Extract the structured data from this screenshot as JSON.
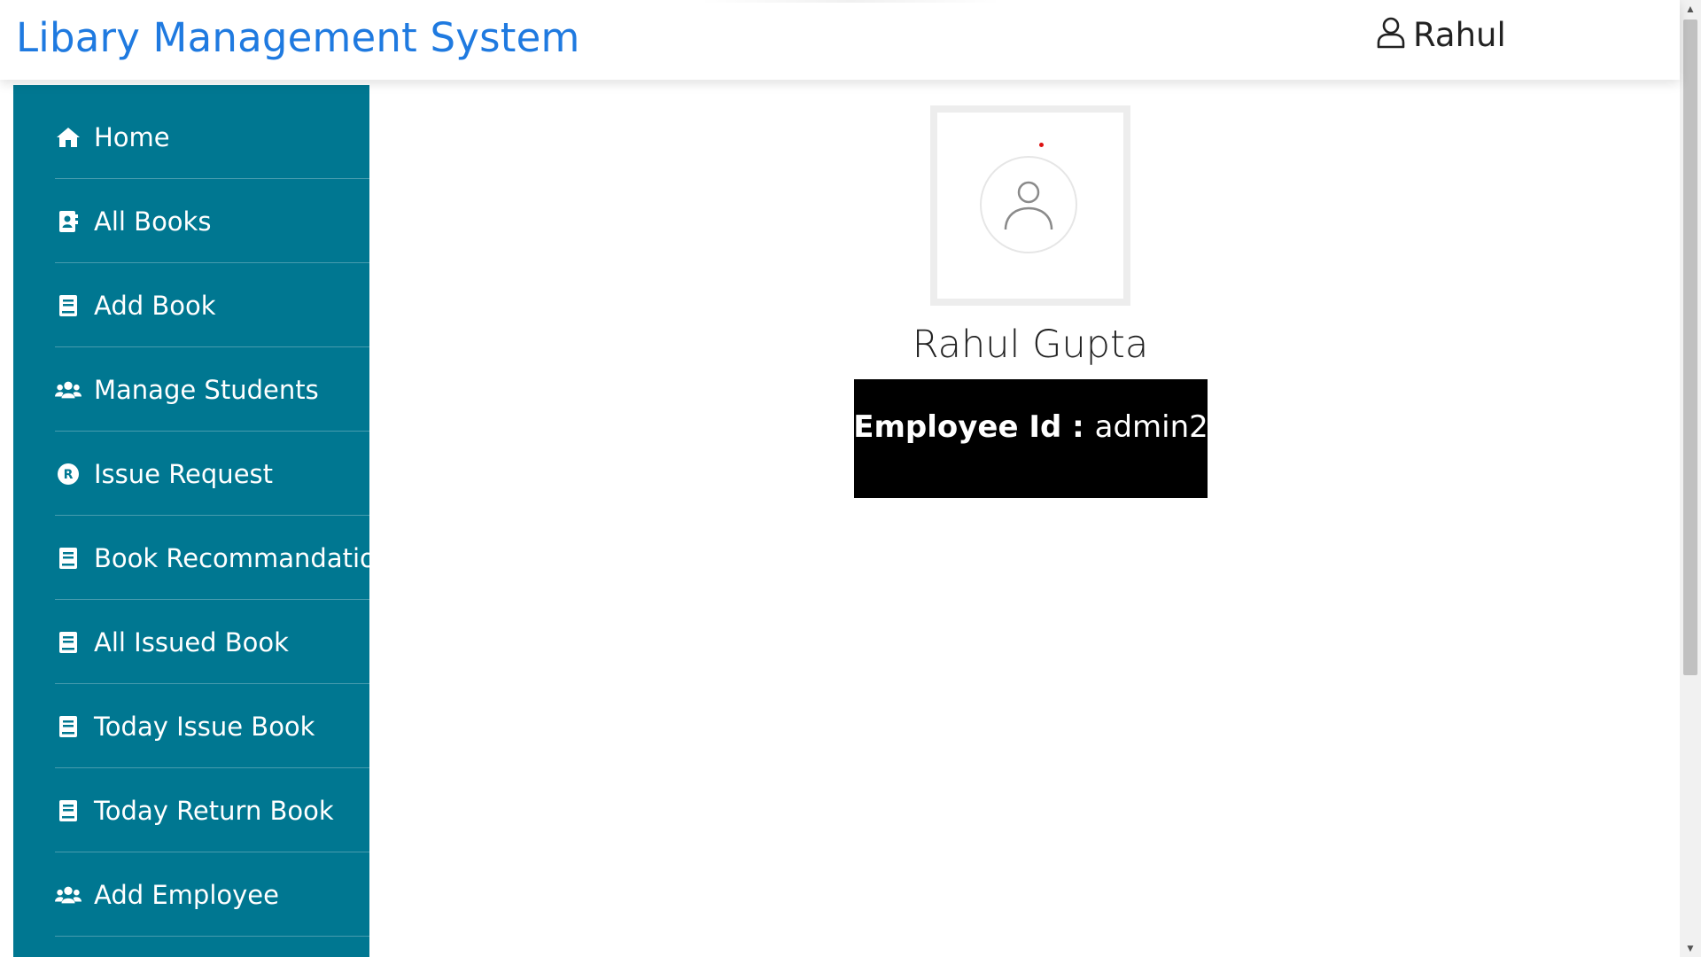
{
  "header": {
    "app_title": "Libary Management System",
    "user_icon": "user-outline-icon",
    "user_name": "Rahul"
  },
  "sidebar": {
    "items": [
      {
        "label": "Home",
        "icon": "home-icon"
      },
      {
        "label": "All Books",
        "icon": "address-book-icon"
      },
      {
        "label": "Add Book",
        "icon": "book-icon"
      },
      {
        "label": "Manage Students",
        "icon": "users-icon"
      },
      {
        "label": "Issue Request",
        "icon": "registered-icon"
      },
      {
        "label": "Book Recommandation",
        "icon": "book-icon"
      },
      {
        "label": "All Issued Book",
        "icon": "book-icon"
      },
      {
        "label": "Today Issue Book",
        "icon": "book-icon"
      },
      {
        "label": "Today Return Book",
        "icon": "book-icon"
      },
      {
        "label": "Add Employee",
        "icon": "users-icon"
      }
    ],
    "background": "#007791"
  },
  "profile": {
    "avatar_icon": "user-avatar-icon",
    "full_name": "Rahul Gupta",
    "employee_id_label": "Employee Id : ",
    "employee_id_value": "admin2"
  },
  "colors": {
    "accent": "#1f7ae0",
    "sidebar": "#007791",
    "id_box": "#000000"
  }
}
